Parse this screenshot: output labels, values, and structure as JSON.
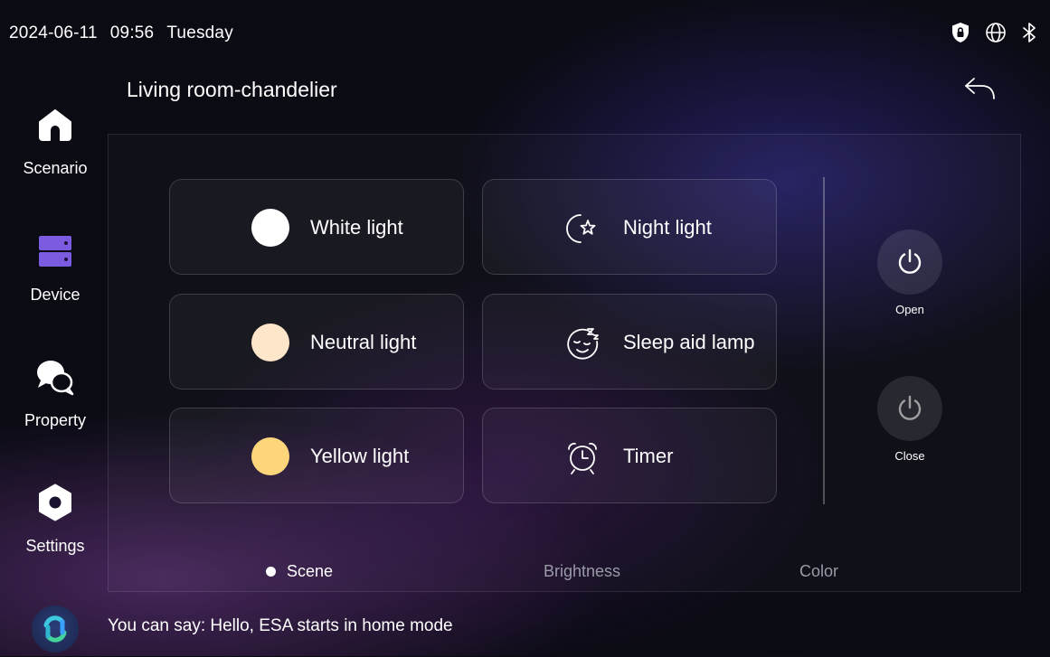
{
  "status_bar": {
    "date": "2024-06-11",
    "time": "09:56",
    "weekday": "Tuesday",
    "icons": [
      "shield-lock-icon",
      "globe-icon",
      "bluetooth-icon"
    ]
  },
  "header": {
    "title": "Living room-chandelier",
    "back_icon": "back-arrow-icon"
  },
  "sidebar": {
    "items": [
      {
        "label": "Scenario",
        "icon": "home-icon"
      },
      {
        "label": "Device",
        "icon": "device-icon"
      },
      {
        "label": "Property",
        "icon": "chat-bubbles-icon"
      },
      {
        "label": "Settings",
        "icon": "gear-icon"
      }
    ]
  },
  "scenes": [
    {
      "label": "White light",
      "color": "#ffffff"
    },
    {
      "label": "Night light",
      "icon": "moon-star-icon"
    },
    {
      "label": "Neutral light",
      "color": "#fde6c9"
    },
    {
      "label": "Sleep aid lamp",
      "icon": "sleep-face-icon"
    },
    {
      "label": "Yellow light",
      "color": "#fdd67b"
    },
    {
      "label": "Timer",
      "icon": "alarm-clock-icon"
    }
  ],
  "power": {
    "open_label": "Open",
    "close_label": "Close"
  },
  "tabs": {
    "active": "Scene",
    "items": [
      "Scene",
      "Brightness",
      "Color"
    ]
  },
  "voice_hint": "You can say: Hello, ESA starts in home mode",
  "colors": {
    "background": "#0b0b14",
    "device_icon": "#7b5ce0",
    "inactive_tab": "#9a9aa8"
  }
}
